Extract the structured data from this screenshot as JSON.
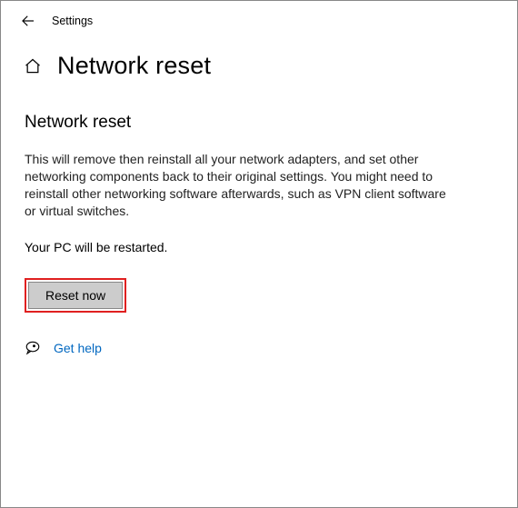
{
  "header": {
    "app_name": "Settings"
  },
  "page": {
    "title": "Network reset",
    "section_heading": "Network reset",
    "description": "This will remove then reinstall all your network adapters, and set other networking components back to their original settings. You might need to reinstall other networking software afterwards, such as VPN client software or virtual switches.",
    "restart_notice": "Your PC will be restarted.",
    "reset_button_label": "Reset now",
    "help_link": "Get help"
  }
}
